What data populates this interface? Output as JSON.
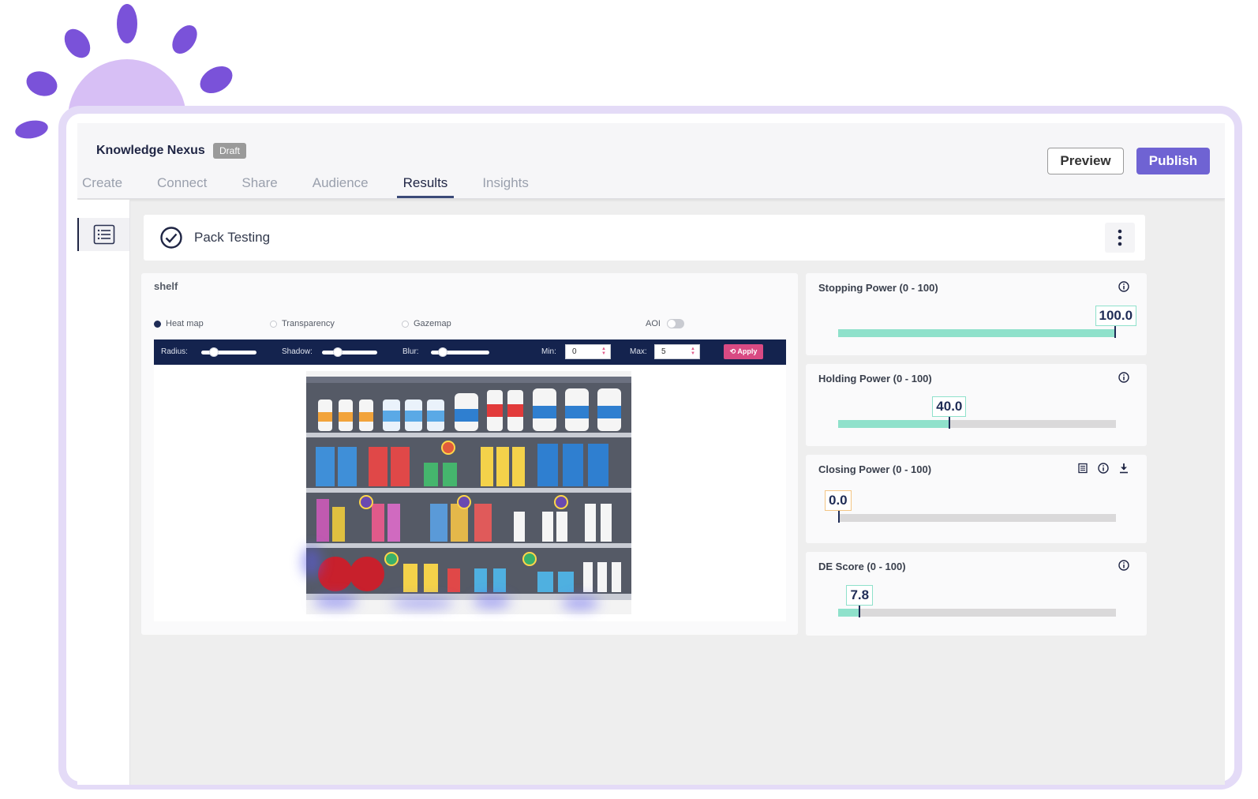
{
  "app": {
    "title": "Knowledge Nexus",
    "status_badge": "Draft",
    "tabs": [
      {
        "label": "Create",
        "active": false
      },
      {
        "label": "Connect",
        "active": false
      },
      {
        "label": "Share",
        "active": false
      },
      {
        "label": "Audience",
        "active": false
      },
      {
        "label": "Results",
        "active": true
      },
      {
        "label": "Insights",
        "active": false
      }
    ],
    "preview_label": "Preview",
    "publish_label": "Publish"
  },
  "page": {
    "title": "Pack Testing"
  },
  "viewer": {
    "label": "shelf",
    "modes": [
      {
        "label": "Heat map",
        "selected": true
      },
      {
        "label": "Transparency",
        "selected": false
      },
      {
        "label": "Gazemap",
        "selected": false
      }
    ],
    "aoi_label": "AOI",
    "aoi_enabled": false,
    "controls": {
      "radius_label": "Radius:",
      "shadow_label": "Shadow:",
      "blur_label": "Blur:",
      "min_label": "Min:",
      "min_value": "0",
      "max_label": "Max:",
      "max_value": "5",
      "apply_label": "Apply"
    }
  },
  "metrics": [
    {
      "title": "Stopping Power (0 - 100)",
      "value": 100.0,
      "display": "100.0",
      "box": "green"
    },
    {
      "title": "Holding Power (0 - 100)",
      "value": 40.0,
      "display": "40.0",
      "box": "green"
    },
    {
      "title": "Closing Power (0 - 100)",
      "value": 0.0,
      "display": "0.0",
      "box": "orange"
    },
    {
      "title": "DE Score (0 - 100)",
      "value": 7.8,
      "display": "7.8",
      "box": "green"
    }
  ],
  "colors": {
    "accent": "#6f63d3",
    "navy": "#14234e",
    "bar_fill": "#8fe1cb",
    "bar_track": "#dad9da",
    "apply": "#d94a83",
    "decor": "#7a52d9"
  },
  "icons": {
    "sidebar": "list-icon",
    "header": "check-circle-icon",
    "menu": "kebab-menu-icon",
    "metric_info": "info-icon",
    "metric_report": "report-icon",
    "metric_download": "download-icon",
    "expand": "chevron-right-icon"
  }
}
